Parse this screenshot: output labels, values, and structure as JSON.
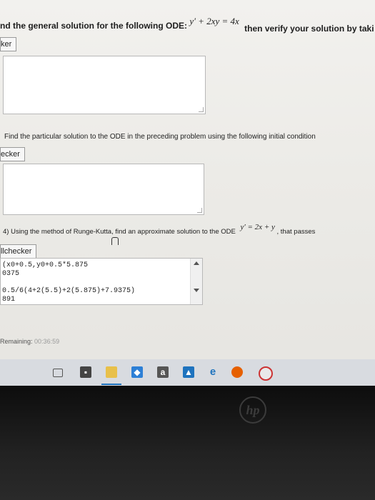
{
  "q1": {
    "text_before": "nd the general solution for the following ODE:",
    "equation": "y′ + 2xy = 4x",
    "text_after": "then verify your solution by taki"
  },
  "q1_button": "ker",
  "q2": {
    "text": "Find the particular solution to the ODE in the preceding problem using the following initial condition"
  },
  "q2_button": "ecker",
  "q4": {
    "text_before": "4) Using the method of Runge-Kutta, find an approximate solution to the ODE",
    "equation": "y′ = 2x + y",
    "text_after": ", that passes"
  },
  "q4_button": "llchecker",
  "answer_lines": [
    "(x0+0.5,y0+0.5*5.875",
    "0375",
    "",
    "0.5/6(4+2(5.5)+2(5.875)+7.9375)",
    "891"
  ],
  "timer": {
    "label": "Remaining:",
    "value": "00:36:59"
  },
  "taskbar": {
    "icons": [
      "task-view-icon",
      "store-icon",
      "file-explorer-icon",
      "dropbox-icon",
      "amazon-icon",
      "photos-icon",
      "edge-icon",
      "firefox-icon",
      "chrome-icon"
    ],
    "amazon_glyph": "a",
    "edge_glyph": "e"
  },
  "brand": "hp",
  "colors": {
    "accent_blue": "#1e73be",
    "timer_gray": "#9a9a9a"
  }
}
